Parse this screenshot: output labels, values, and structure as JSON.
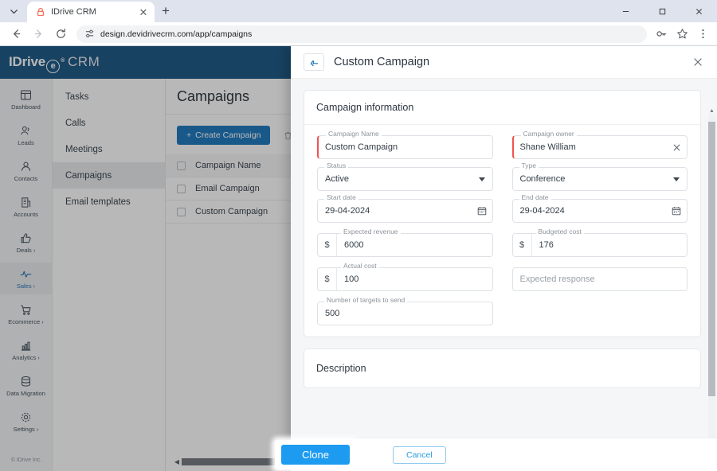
{
  "browser": {
    "tab": {
      "title": "IDrive CRM",
      "favicon": "lock-icon"
    },
    "new_tab_label": "+",
    "url": "design.devidrivecrm.com/app/campaigns",
    "nav": {
      "back": "back-arrow",
      "forward": "forward-arrow",
      "reload": "reload-icon"
    },
    "omnibox_icon": "site-settings-icon",
    "toolbar_icons": [
      "password-key-icon",
      "bookmark-star-icon",
      "chrome-menu-icon"
    ],
    "window_controls": {
      "minimize": "–",
      "maximize": "▢",
      "close": "✕"
    }
  },
  "app": {
    "brand": {
      "name": "IDrive",
      "mark": "e",
      "reg": "®",
      "suffix": "CRM",
      "color": "#125280"
    },
    "rail": [
      {
        "label": "Dashboard",
        "icon": "dashboard-icon",
        "active": false,
        "chevron": false
      },
      {
        "label": "Leads",
        "icon": "leads-icon",
        "active": false,
        "chevron": false
      },
      {
        "label": "Contacts",
        "icon": "contacts-icon",
        "active": false,
        "chevron": false
      },
      {
        "label": "Accounts",
        "icon": "accounts-icon",
        "active": false,
        "chevron": false
      },
      {
        "label": "Deals",
        "icon": "deals-icon",
        "active": false,
        "chevron": true
      },
      {
        "label": "Sales",
        "icon": "sales-icon",
        "active": true,
        "chevron": true
      },
      {
        "label": "Ecommerce",
        "icon": "ecommerce-icon",
        "active": false,
        "chevron": true
      },
      {
        "label": "Analytics",
        "icon": "analytics-icon",
        "active": false,
        "chevron": true
      },
      {
        "label": "Data Migration",
        "icon": "data-migration-icon",
        "active": false,
        "chevron": false
      },
      {
        "label": "Settings",
        "icon": "settings-gear-icon",
        "active": false,
        "chevron": true
      }
    ],
    "rail_footer": "© IDrive Inc.",
    "submenu": [
      {
        "label": "Tasks",
        "active": false
      },
      {
        "label": "Calls",
        "active": false
      },
      {
        "label": "Meetings",
        "active": false
      },
      {
        "label": "Campaigns",
        "active": true
      },
      {
        "label": "Email templates",
        "active": false
      }
    ],
    "content": {
      "title": "Campaigns",
      "create_button": "Create Campaign",
      "create_button_icon": "plus-icon",
      "delete_icon": "trash-icon",
      "table": {
        "header": "Campaign Name",
        "rows": [
          "Email Campaign",
          "Custom Campaign"
        ]
      }
    }
  },
  "modal": {
    "title": "Custom Campaign",
    "back_icon": "back-arrow-icon",
    "close_icon": "close-icon",
    "section_title": "Campaign information",
    "fields": {
      "campaign_name": {
        "label": "Campaign Name",
        "value": "Custom Campaign",
        "required": true
      },
      "campaign_owner": {
        "label": "Campaign owner",
        "value": "Shane William",
        "required": true,
        "clear_icon": "clear-x-icon"
      },
      "status": {
        "label": "Status",
        "value": "Active",
        "caret": "chevron-down-icon"
      },
      "type": {
        "label": "Type",
        "value": "Conference",
        "caret": "chevron-down-icon"
      },
      "start_date": {
        "label": "Start date",
        "value": "29-04-2024",
        "icon": "calendar-icon"
      },
      "end_date": {
        "label": "End date",
        "value": "29-04-2024",
        "icon": "calendar-icon"
      },
      "expected_revenue": {
        "label": "Expected revenue",
        "value": "6000",
        "currency": "$"
      },
      "budgeted_cost": {
        "label": "Budgeted cost",
        "value": "176",
        "currency": "$"
      },
      "actual_cost": {
        "label": "Actual cost",
        "value": "100",
        "currency": "$"
      },
      "expected_response": {
        "label": "",
        "placeholder": "Expected response",
        "value": ""
      },
      "number_of_targets": {
        "label": "Number of targets to send",
        "value": "500"
      }
    },
    "description_title": "Description",
    "footer": {
      "primary_label": "Clone",
      "secondary_label": "Cancel",
      "primary_color": "#1d9bf0",
      "secondary_color": "#2a9bdf"
    }
  }
}
